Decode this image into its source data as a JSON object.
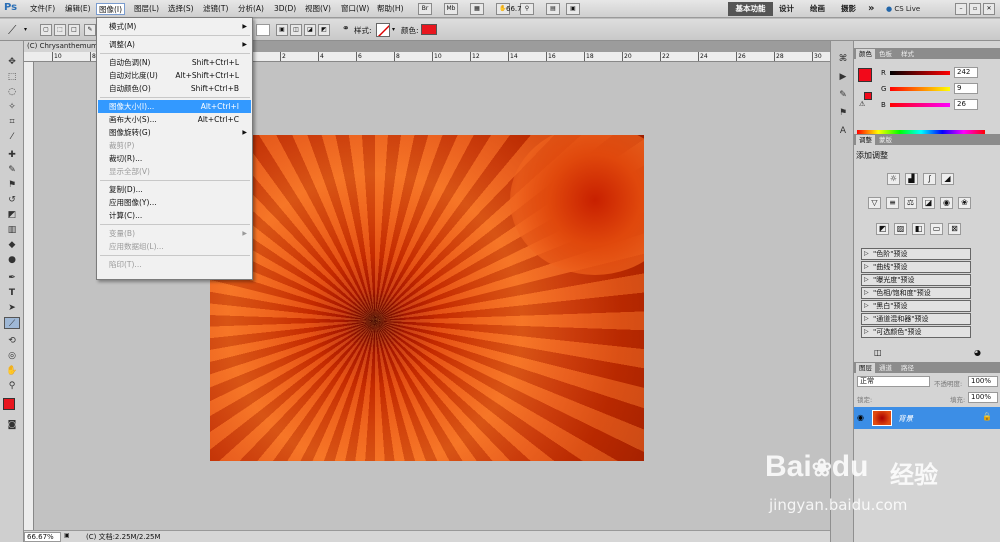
{
  "app_logo": "Ps",
  "menubar": {
    "items": [
      "文件(F)",
      "编辑(E)",
      "图像(I)",
      "图层(L)",
      "选择(S)",
      "滤镜(T)",
      "分析(A)",
      "3D(D)",
      "视图(V)",
      "窗口(W)",
      "帮助(H)"
    ],
    "zoom": "66.7",
    "workspaces": [
      "基本功能",
      "设计",
      "绘画",
      "摄影"
    ],
    "more": "»",
    "cslive": "CS Live"
  },
  "options": {
    "style_label": "样式:",
    "color_label": "颜色:",
    "color_value": "#e8161e"
  },
  "document": {
    "tab_title": "(C) Chrysanthemum",
    "zoom_status": "66.67%",
    "doc_info": "(C) 文档:2.25M/2.25M"
  },
  "ruler": {
    "ticks": [
      "10",
      "8",
      "6",
      "4",
      "2",
      "0",
      "2",
      "4",
      "6",
      "8",
      "10",
      "12",
      "14",
      "16",
      "18",
      "20",
      "22",
      "24",
      "26",
      "28",
      "30"
    ]
  },
  "image_menu": {
    "items": [
      {
        "label": "模式(M)",
        "shortcut": "",
        "arrow": true,
        "disabled": false
      },
      {
        "sep": true
      },
      {
        "label": "调整(A)",
        "shortcut": "",
        "arrow": true,
        "disabled": false
      },
      {
        "sep": true
      },
      {
        "label": "自动色调(N)",
        "shortcut": "Shift+Ctrl+L",
        "arrow": false,
        "disabled": false
      },
      {
        "label": "自动对比度(U)",
        "shortcut": "Alt+Shift+Ctrl+L",
        "arrow": false,
        "disabled": false
      },
      {
        "label": "自动颜色(O)",
        "shortcut": "Shift+Ctrl+B",
        "arrow": false,
        "disabled": false
      },
      {
        "sep": true
      },
      {
        "label": "图像大小(I)...",
        "shortcut": "Alt+Ctrl+I",
        "arrow": false,
        "disabled": false,
        "highlight": true
      },
      {
        "label": "画布大小(S)...",
        "shortcut": "Alt+Ctrl+C",
        "arrow": false,
        "disabled": false
      },
      {
        "label": "图像旋转(G)",
        "shortcut": "",
        "arrow": true,
        "disabled": false
      },
      {
        "label": "裁剪(P)",
        "shortcut": "",
        "arrow": false,
        "disabled": true
      },
      {
        "label": "裁切(R)...",
        "shortcut": "",
        "arrow": false,
        "disabled": false
      },
      {
        "label": "显示全部(V)",
        "shortcut": "",
        "arrow": false,
        "disabled": true
      },
      {
        "sep": true
      },
      {
        "label": "复制(D)...",
        "shortcut": "",
        "arrow": false,
        "disabled": false
      },
      {
        "label": "应用图像(Y)...",
        "shortcut": "",
        "arrow": false,
        "disabled": false
      },
      {
        "label": "计算(C)...",
        "shortcut": "",
        "arrow": false,
        "disabled": false
      },
      {
        "sep": true
      },
      {
        "label": "变量(B)",
        "shortcut": "",
        "arrow": true,
        "disabled": true
      },
      {
        "label": "应用数据组(L)...",
        "shortcut": "",
        "arrow": false,
        "disabled": true
      },
      {
        "sep": true
      },
      {
        "label": "陷印(T)...",
        "shortcut": "",
        "arrow": false,
        "disabled": true
      }
    ]
  },
  "color_panel": {
    "tabs": [
      "颜色",
      "色板",
      "样式"
    ],
    "r_label": "R",
    "r_value": "242",
    "g_label": "G",
    "g_value": "9",
    "b_label": "B",
    "b_value": "26",
    "foreground": "#f2091a"
  },
  "adjust_panel": {
    "tabs": [
      "调整",
      "蒙版"
    ],
    "title": "添加调整",
    "presets": [
      "\"色阶\"预设",
      "\"曲线\"预设",
      "\"曝光度\"预设",
      "\"色相/饱和度\"预设",
      "\"黑白\"预设",
      "\"通道混和器\"预设",
      "\"可选颜色\"预设"
    ]
  },
  "layers_panel": {
    "tabs": [
      "图层",
      "通道",
      "路径"
    ],
    "blend_mode": "正常",
    "opacity_label": "不透明度:",
    "opacity_value": "100%",
    "lock_label": "锁定:",
    "fill_label": "填充:",
    "fill_value": "100%",
    "layer_name": "背景"
  },
  "watermark": {
    "brand": "Bai",
    "brand2": "du",
    "cn": "经验",
    "url": "jingyan.baidu.com"
  }
}
